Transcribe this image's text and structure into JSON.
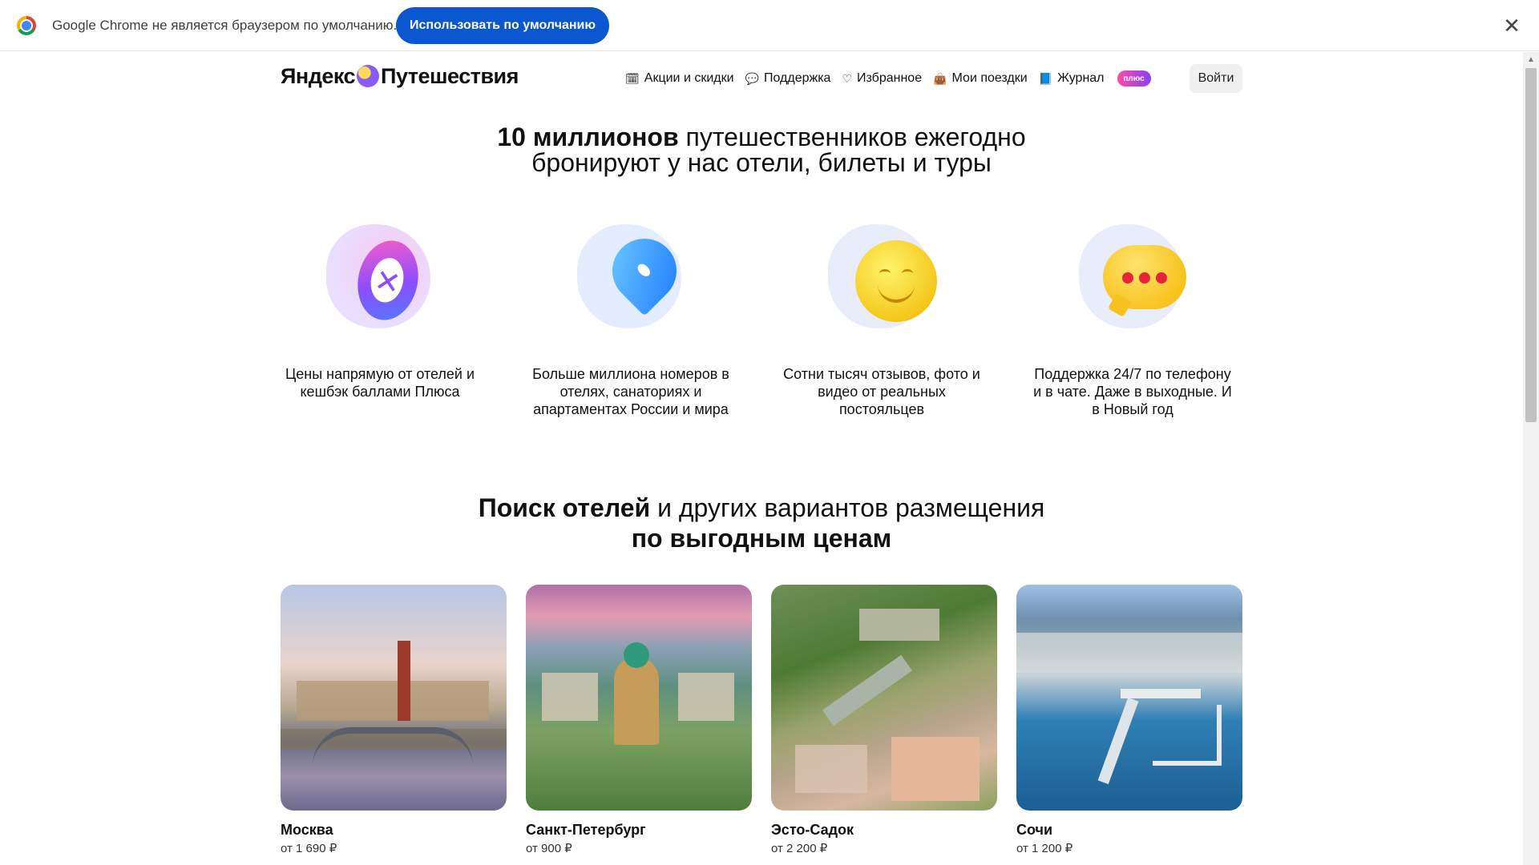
{
  "infobar": {
    "message": "Google Chrome не является браузером по умолчанию.",
    "button_label": "Использовать по умолчанию",
    "close_glyph": "✕"
  },
  "header": {
    "logo_left": "Яндекс",
    "logo_right": "Путешествия",
    "nav": [
      {
        "label": "Акции и скидки",
        "icon": "calendar-icon",
        "glyph": "🗓"
      },
      {
        "label": "Поддержка",
        "icon": "chat-bubble-icon",
        "glyph": "💬"
      },
      {
        "label": "Избранное",
        "icon": "heart-icon",
        "glyph": "♡"
      },
      {
        "label": "Мои поездки",
        "icon": "suitcase-icon",
        "glyph": "👜"
      },
      {
        "label": "Журнал",
        "icon": "book-icon",
        "glyph": "📘"
      }
    ],
    "plus_badge": "плюс",
    "login_label": "Войти"
  },
  "hero": {
    "bold": "10 миллионов",
    "line1_rest": " путешественников ежегодно",
    "line2": "бронируют у нас отели, билеты и туры"
  },
  "features": [
    {
      "icon": "cashback-icon",
      "text": "Цены напрямую от отелей и кешбэк баллами Плюса"
    },
    {
      "icon": "location-pin-icon",
      "text": "Больше миллиона номеров в отелях, санаториях и апартаментах России и мира"
    },
    {
      "icon": "smile-icon",
      "text": "Сотни тысяч отзывов, фото и видео от реальных постояльцев"
    },
    {
      "icon": "chat-dots-icon",
      "text": "Поддержка 24/7 по телефону и в чате. Даже в выходные. И в Новый год"
    }
  ],
  "section": {
    "title_bold": "Поиск отелей",
    "title_rest": " и других вариантов размещения",
    "subtitle_bold": "по выгодным ценам"
  },
  "cities": [
    {
      "name": "Москва",
      "price": "от 1 690 ₽"
    },
    {
      "name": "Санкт-Петербург",
      "price": "от 900 ₽"
    },
    {
      "name": "Эсто-Садок",
      "price": "от 2 200 ₽"
    },
    {
      "name": "Сочи",
      "price": "от 1 200 ₽"
    }
  ],
  "colors": {
    "accent_blue": "#0b57d0",
    "plus_gradient": [
      "#ff4aa5",
      "#8a3ffc"
    ]
  }
}
